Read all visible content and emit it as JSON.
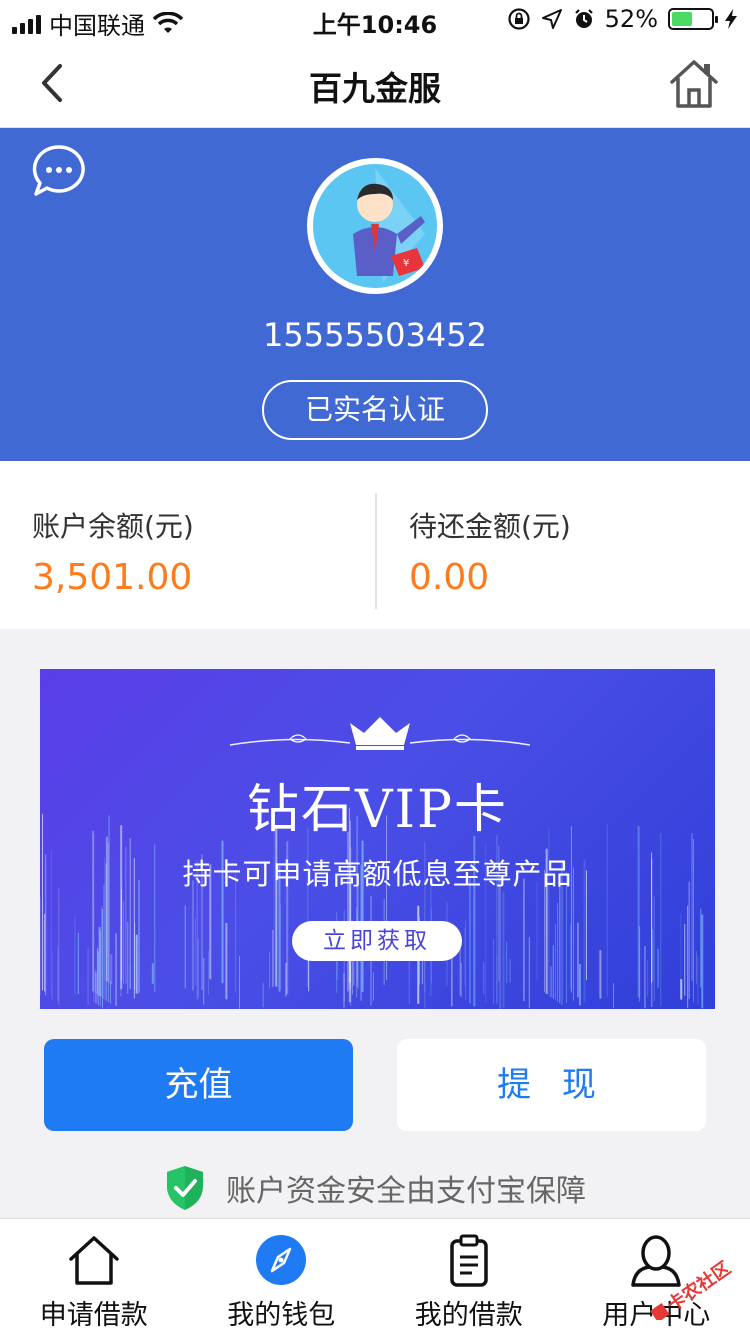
{
  "status_bar": {
    "carrier": "中国联通",
    "time": "上午10:46",
    "battery": "52%",
    "battery_level": 0.52,
    "icons": [
      "signal-icon",
      "wifi-icon",
      "rotation-lock-icon",
      "location-icon",
      "alarm-icon",
      "battery-icon",
      "charging-icon"
    ]
  },
  "nav": {
    "title": "百九金服",
    "back_icon": "chevron-left-icon",
    "home_icon": "home-icon"
  },
  "profile": {
    "message_icon": "chat-bubble-icon",
    "phone": "15555503452",
    "verify_label": "已实名认证",
    "header_color": "#4169d4"
  },
  "balances": {
    "account_label": "账户余额(元)",
    "account_value": "3,501.00",
    "pending_label": "待还金额(元)",
    "pending_value": "0.00",
    "value_color": "#ff7a1a"
  },
  "banner": {
    "title": "钻石VIP卡",
    "subtitle": "持卡可申请高额低息至尊产品",
    "cta": "立即获取"
  },
  "actions": {
    "recharge": "充值",
    "withdraw": "提 现",
    "accent": "#1f7bf3"
  },
  "security": {
    "text": "账户资金安全由支付宝保障",
    "icon": "shield-check-icon"
  },
  "tabbar": {
    "items": [
      {
        "label": "申请借款",
        "icon": "home-icon"
      },
      {
        "label": "我的钱包",
        "icon": "compass-icon",
        "active": true
      },
      {
        "label": "我的借款",
        "icon": "clipboard-icon"
      },
      {
        "label": "用户中心",
        "icon": "user-icon"
      }
    ]
  },
  "watermark": {
    "text": "卡农社区"
  }
}
